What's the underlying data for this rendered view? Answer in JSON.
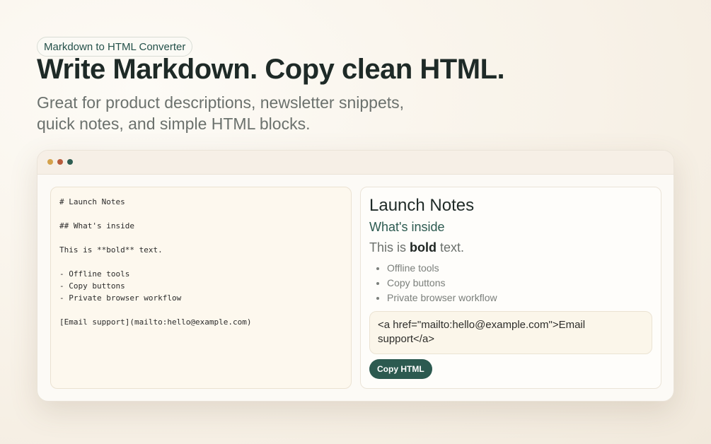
{
  "hero": {
    "badge": "Markdown to HTML Converter",
    "title": "Write Markdown. Copy clean HTML.",
    "subtitle": "Great for product descriptions, newsletter snippets, quick notes, and simple HTML blocks."
  },
  "window": {
    "dots": [
      "#d4a24c",
      "#b85c3c",
      "#2e5d52"
    ]
  },
  "editor": {
    "value": "# Launch Notes\n\n## What's inside\n\nThis is **bold** text.\n\n- Offline tools\n- Copy buttons\n- Private browser workflow\n\n[Email support](mailto:hello@example.com)"
  },
  "preview": {
    "h1": "Launch Notes",
    "h2": "What's inside",
    "paragraph": {
      "before": "This is ",
      "bold": "bold",
      "after": " text."
    },
    "list": [
      "Offline tools",
      "Copy buttons",
      "Private browser workflow"
    ],
    "html_output": "<a href=\"mailto:hello@example.com\">Email support</a>",
    "copy_label": "Copy HTML"
  },
  "colors": {
    "accent": "#2c5a50",
    "heading": "#1e2a27",
    "muted": "#6b716d"
  }
}
